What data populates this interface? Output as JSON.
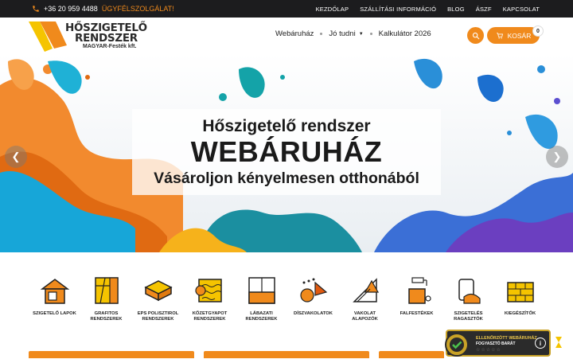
{
  "topbar": {
    "phone": "+36 20 959 4488",
    "customer_service": "ÜGYFÉLSZOLGÁLAT!",
    "menu": [
      "KEZDŐLAP",
      "SZÁLLÍTÁSI INFORMÁCIÓ",
      "BLOG",
      "ÁSZF",
      "KAPCSOLAT"
    ]
  },
  "logo": {
    "line1": "HŐSZIGETELŐ",
    "line2": "RENDSZER",
    "line3": "MAGYAR-Festék kft."
  },
  "nav": {
    "webshop": "Webáruház",
    "good_to_know": "Jó tudni",
    "calculator": "Kalkulátor 2026"
  },
  "cart": {
    "label": "KOSÁR",
    "count": "0"
  },
  "hero": {
    "line1": "Hőszigetelő rendszer",
    "line2": "WEBÁRUHÁZ",
    "line3": "Vásároljon kényelmesen otthonából"
  },
  "categories": [
    {
      "label": "SZIGETELŐ LAPOK",
      "icon": "house-icon"
    },
    {
      "label": "GRAFITOS RENDSZEREK",
      "icon": "graphite-panel-icon"
    },
    {
      "label": "EPS POLISZTIROL RENDSZEREK",
      "icon": "eps-board-icon"
    },
    {
      "label": "KŐZETGYAPOT RENDSZEREK",
      "icon": "rockwool-roll-icon"
    },
    {
      "label": "LÁBAZATI RENDSZEREK",
      "icon": "plinth-icon"
    },
    {
      "label": "DÍSZVAKOLATOK",
      "icon": "decorative-plaster-icon"
    },
    {
      "label": "VAKOLAT ALAPOZÓK",
      "icon": "primer-trowel-icon"
    },
    {
      "label": "FALFESTÉKEK",
      "icon": "paint-roller-icon"
    },
    {
      "label": "SZIGETELÉS RAGASZTÓK",
      "icon": "adhesive-bag-icon"
    },
    {
      "label": "KIEGÉSZÍTŐK",
      "icon": "brick-wall-icon"
    }
  ],
  "badge": {
    "title": "ELLENŐRZÖTT WEBÁRUHÁZ",
    "subtitle": "FOGYASZTÓ BARÁT",
    "stars": "☆☆☆☆☆"
  },
  "colors": {
    "accent": "#f08a1c",
    "topbar": "#1c1c1e",
    "text": "#222222"
  }
}
